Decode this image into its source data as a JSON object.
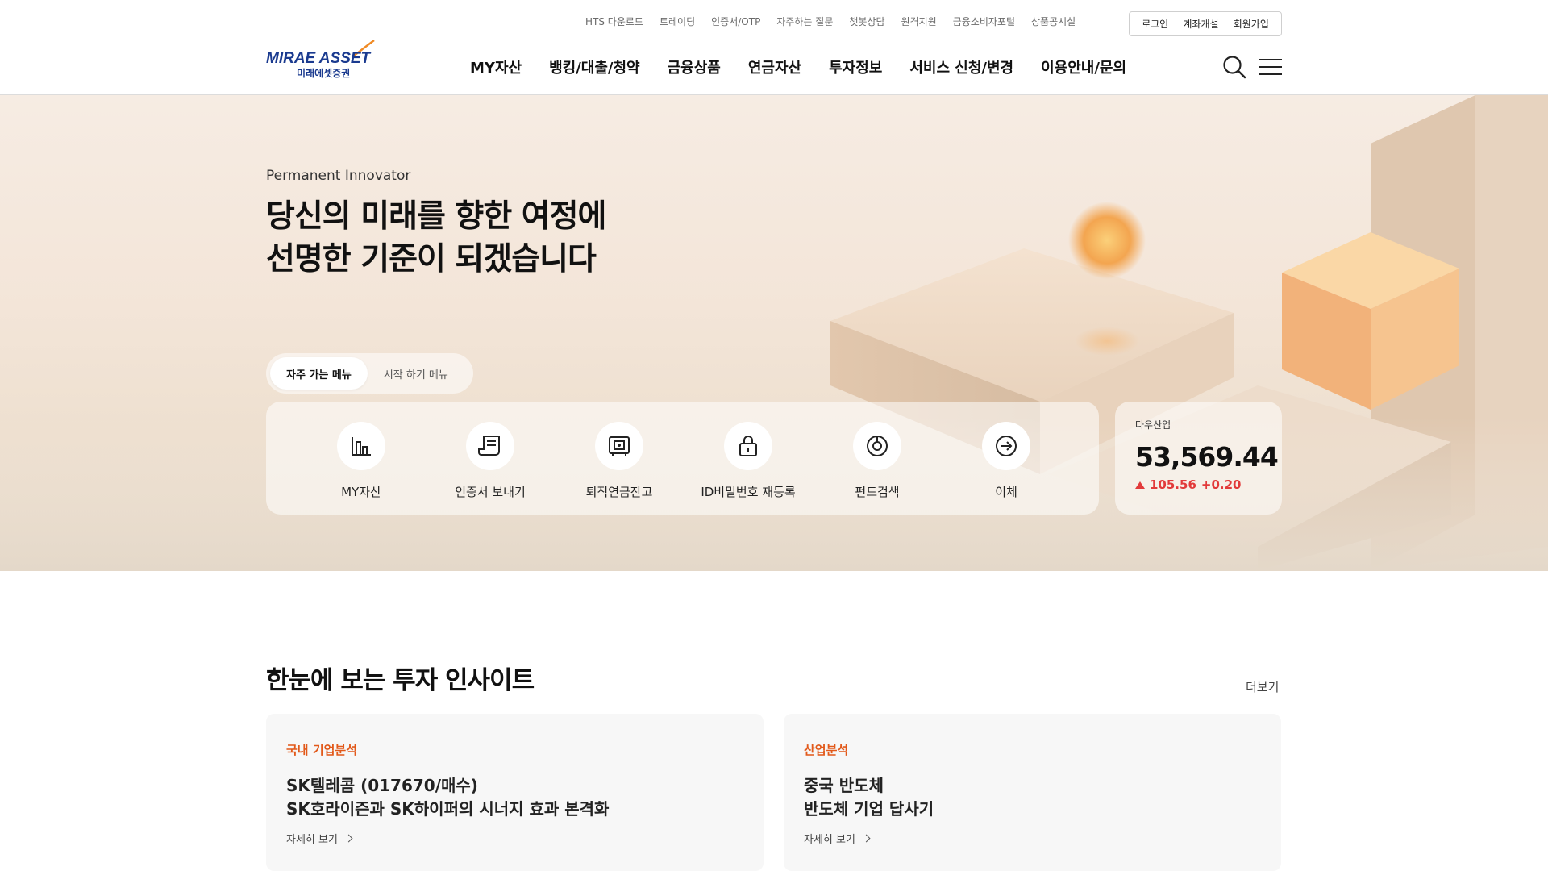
{
  "header": {
    "util_links": [
      "HTS 다운로드",
      "트레이딩",
      "인증서/OTP",
      "자주하는 질문",
      "챗봇상담",
      "원격지원",
      "금융소비자포털",
      "상품공시실"
    ],
    "auth": {
      "login": "로그인",
      "open_account": "계좌개설",
      "signup": "회원가입"
    },
    "logo": {
      "brand": "MIRAE ASSET",
      "brand_ko": "미래에셋증권"
    },
    "nav": [
      "MY자산",
      "뱅킹/대출/청약",
      "금융상품",
      "연금자산",
      "투자정보",
      "서비스 신청/변경",
      "이용안내/문의"
    ],
    "icons": {
      "search": "search-icon",
      "menu": "hamburger-menu-icon"
    }
  },
  "hero": {
    "tagline": "Permanent Innovator",
    "headline_line1": "당신의 미래를 향한 여정에",
    "headline_line2": "선명한 기준이 되겠습니다",
    "tabs": [
      {
        "label": "자주 가는 메뉴",
        "active": true
      },
      {
        "label": "시작 하기 메뉴",
        "active": false
      }
    ],
    "quick_menu": [
      {
        "label": "MY자산",
        "icon": "bar-chart-icon"
      },
      {
        "label": "인증서 보내기",
        "icon": "certificate-icon"
      },
      {
        "label": "퇴직연금잔고",
        "icon": "safe-icon"
      },
      {
        "label": "ID비밀번호 재등록",
        "icon": "lock-icon"
      },
      {
        "label": "펀드검색",
        "icon": "fund-search-icon"
      },
      {
        "label": "이체",
        "icon": "transfer-icon"
      }
    ],
    "index": {
      "name": "다우산업",
      "value": "53,569.44",
      "change": "105.56",
      "change_rate": "+0.20",
      "color_up": "#e23a3a"
    }
  },
  "insight": {
    "title": "한눈에 보는 투자 인사이트",
    "more": "더보기",
    "cards": [
      {
        "category": "국내 기업분석",
        "title_line1": "SK텔레콤 (017670/매수)",
        "title_line2": "SK호라이즌과 SK하이퍼의 시너지 효과 본격화",
        "link": "자세히 보기"
      },
      {
        "category": "산업분석",
        "title_line1": "중국 반도체",
        "title_line2": "반도체 기업 답사기",
        "link": "자세히 보기"
      }
    ]
  },
  "colors": {
    "accent_orange": "#e2591a",
    "brand_blue": "#1a3a8f",
    "up_red": "#e23a3a"
  }
}
